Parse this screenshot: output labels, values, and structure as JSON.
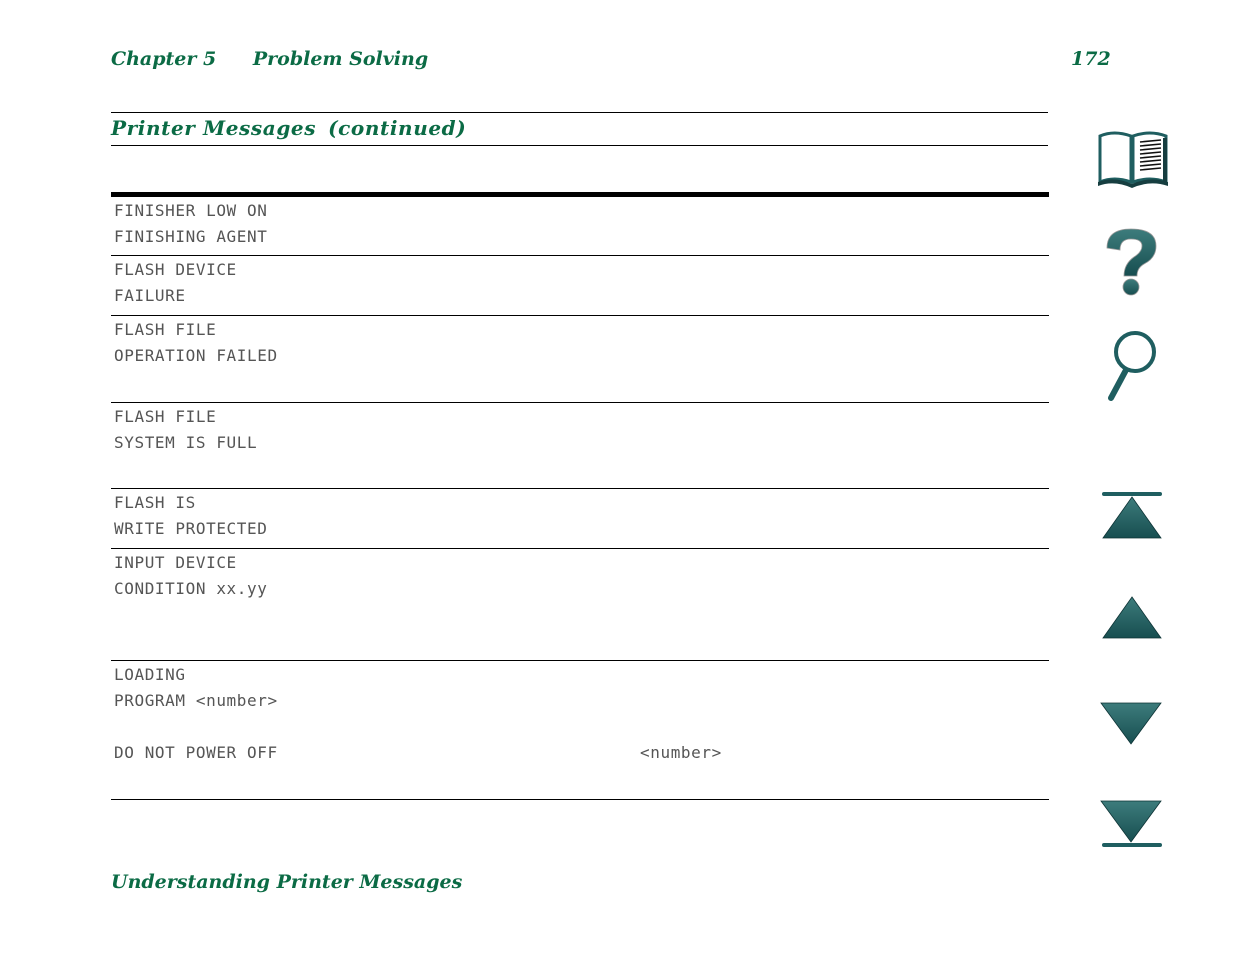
{
  "header": {
    "chapter": "Chapter 5",
    "chapter_title": "Problem Solving",
    "page_number": "172"
  },
  "section": {
    "title": "Printer Messages",
    "continued": "(continued)"
  },
  "messages": [
    {
      "lines": [
        "FINISHER LOW ON",
        "FINISHING AGENT"
      ]
    },
    {
      "lines": [
        "FLASH DEVICE",
        "FAILURE"
      ]
    },
    {
      "lines": [
        "FLASH FILE",
        "OPERATION FAILED"
      ]
    },
    {
      "lines": [
        "FLASH FILE",
        "SYSTEM IS FULL"
      ]
    },
    {
      "lines": [
        "FLASH IS",
        "WRITE PROTECTED"
      ]
    },
    {
      "lines": [
        "INPUT DEVICE",
        "CONDITION xx.yy"
      ]
    },
    {
      "lines": [
        "LOADING",
        "PROGRAM <number>",
        "DO NOT POWER OFF"
      ],
      "right_text": "<number>"
    }
  ],
  "footer": {
    "title": "Understanding Printer Messages"
  },
  "nav_icons": [
    {
      "name": "contents-book-icon"
    },
    {
      "name": "help-question-icon"
    },
    {
      "name": "search-magnifier-icon"
    },
    {
      "name": "first-page-icon"
    },
    {
      "name": "previous-page-icon"
    },
    {
      "name": "next-page-icon"
    },
    {
      "name": "last-page-icon"
    }
  ],
  "colors": {
    "heading_green": "#0b6b45",
    "nav_teal": "#1f5e60",
    "lcd_text": "#555555"
  }
}
